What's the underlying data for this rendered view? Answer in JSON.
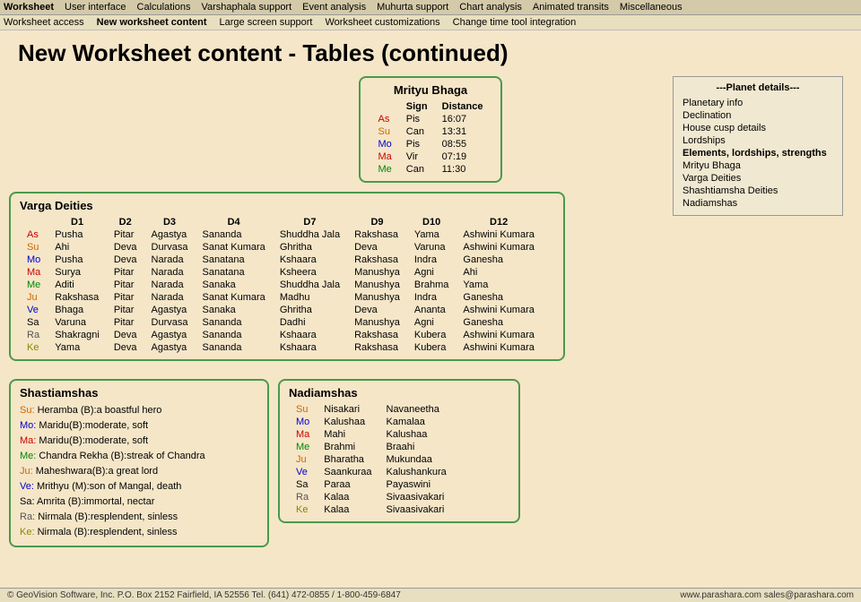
{
  "topnav": {
    "items": [
      {
        "label": "Worksheet",
        "bold": true
      },
      {
        "label": "User interface"
      },
      {
        "label": "Calculations"
      },
      {
        "label": "Varshaphala support"
      },
      {
        "label": "Event analysis"
      },
      {
        "label": "Muhurta support"
      },
      {
        "label": "Chart analysis"
      },
      {
        "label": "Animated transits"
      },
      {
        "label": "Miscellaneous"
      }
    ]
  },
  "secondnav": {
    "items": [
      {
        "label": "Worksheet access"
      },
      {
        "label": "New worksheet content",
        "bold": true
      },
      {
        "label": "Large screen support"
      },
      {
        "label": "Worksheet customizations"
      },
      {
        "label": "Change time tool integration"
      }
    ]
  },
  "page_title": "New Worksheet content - Tables (continued)",
  "mrityu": {
    "title": "Mrityu Bhaga",
    "col_headers": [
      "",
      "Sign",
      "Distance"
    ],
    "rows": [
      {
        "planet": "As",
        "color": "col-as",
        "sign": "Pis",
        "distance": "16:07"
      },
      {
        "planet": "Su",
        "color": "col-su",
        "sign": "Can",
        "distance": "13:31"
      },
      {
        "planet": "Mo",
        "color": "col-mo",
        "sign": "Pis",
        "distance": "08:55"
      },
      {
        "planet": "Ma",
        "color": "col-ma",
        "sign": "Vir",
        "distance": "07:19"
      },
      {
        "planet": "Me",
        "color": "col-me",
        "sign": "Can",
        "distance": "11:30"
      }
    ]
  },
  "varga": {
    "title": "Varga Deities",
    "col_headers": [
      "",
      "D1",
      "D2",
      "D3",
      "D4",
      "D7",
      "D9",
      "D10",
      "D12"
    ],
    "rows": [
      {
        "planet": "As",
        "color": "col-as",
        "d1": "Pusha",
        "d2": "Pitar",
        "d3": "Agastya",
        "d4": "Sananda",
        "d7": "Shuddha Jala",
        "d9": "Rakshasa",
        "d10": "Yama",
        "d12": "Ashwini Kumara"
      },
      {
        "planet": "Su",
        "color": "col-su",
        "d1": "Ahi",
        "d2": "Deva",
        "d3": "Durvasa",
        "d4": "Sanat Kumara",
        "d7": "Ghritha",
        "d9": "Deva",
        "d10": "Varuna",
        "d12": "Ashwini Kumara"
      },
      {
        "planet": "Mo",
        "color": "col-mo",
        "d1": "Pusha",
        "d2": "Deva",
        "d3": "Narada",
        "d4": "Sanatana",
        "d7": "Kshaara",
        "d9": "Rakshasa",
        "d10": "Indra",
        "d12": "Ganesha"
      },
      {
        "planet": "Ma",
        "color": "col-ma",
        "d1": "Surya",
        "d2": "Pitar",
        "d3": "Narada",
        "d4": "Sanatana",
        "d7": "Ksheera",
        "d9": "Manushya",
        "d10": "Agni",
        "d12": "Ahi"
      },
      {
        "planet": "Me",
        "color": "col-me",
        "d1": "Aditi",
        "d2": "Pitar",
        "d3": "Narada",
        "d4": "Sanaka",
        "d7": "Shuddha Jala",
        "d9": "Manushya",
        "d10": "Brahma",
        "d12": "Yama"
      },
      {
        "planet": "Ju",
        "color": "col-ju",
        "d1": "Rakshasa",
        "d2": "Pitar",
        "d3": "Narada",
        "d4": "Sanat Kumara",
        "d7": "Madhu",
        "d9": "Manushya",
        "d10": "Indra",
        "d12": "Ganesha"
      },
      {
        "planet": "Ve",
        "color": "col-ve",
        "d1": "Bhaga",
        "d2": "Pitar",
        "d3": "Agastya",
        "d4": "Sanaka",
        "d7": "Ghritha",
        "d9": "Deva",
        "d10": "Ananta",
        "d12": "Ashwini Kumara"
      },
      {
        "planet": "Sa",
        "color": "col-sa",
        "d1": "Varuna",
        "d2": "Pitar",
        "d3": "Durvasa",
        "d4": "Sananda",
        "d7": "Dadhi",
        "d9": "Manushya",
        "d10": "Agni",
        "d12": "Ganesha"
      },
      {
        "planet": "Ra",
        "color": "col-ra",
        "d1": "Shakragni",
        "d2": "Deva",
        "d3": "Agastya",
        "d4": "Sananda",
        "d7": "Kshaara",
        "d9": "Rakshasa",
        "d10": "Kubera",
        "d12": "Ashwini Kumara"
      },
      {
        "planet": "Ke",
        "color": "col-ke",
        "d1": "Yama",
        "d2": "Deva",
        "d3": "Agastya",
        "d4": "Sananda",
        "d7": "Kshaara",
        "d9": "Rakshasa",
        "d10": "Kubera",
        "d12": "Ashwini Kumara"
      }
    ]
  },
  "shastiamshas": {
    "title": "Shastiamshas",
    "lines": [
      {
        "planet": "Su:",
        "color": "col-su",
        "text": "Heramba (B):a boastful hero"
      },
      {
        "planet": "Mo:",
        "color": "col-mo",
        "text": "Maridu(B):moderate, soft"
      },
      {
        "planet": "Ma:",
        "color": "col-ma",
        "text": "Maridu(B):moderate, soft"
      },
      {
        "planet": "Me:",
        "color": "col-me",
        "text": "Chandra Rekha (B):streak of Chandra"
      },
      {
        "planet": "Ju:",
        "color": "col-ju",
        "text": "Maheshwara(B):a great lord"
      },
      {
        "planet": "Ve:",
        "color": "col-ve",
        "text": "Mrithyu (M):son of Mangal, death"
      },
      {
        "planet": "Sa:",
        "color": "col-sa",
        "text": "Amrita (B):immortal, nectar"
      },
      {
        "planet": "Ra:",
        "color": "col-ra",
        "text": "Nirmala (B):resplendent, sinless"
      },
      {
        "planet": "Ke:",
        "color": "col-ke",
        "text": "Nirmala (B):resplendent, sinless"
      }
    ]
  },
  "nadiamshas": {
    "title": "Nadiamshas",
    "rows": [
      {
        "planet": "Su",
        "color": "col-su",
        "col1": "Nisakari",
        "col2": "Navaneetha"
      },
      {
        "planet": "Mo",
        "color": "col-mo",
        "col1": "Kalushaa",
        "col2": "Kamalaa"
      },
      {
        "planet": "Ma",
        "color": "col-ma",
        "col1": "Mahi",
        "col2": "Kalushaa"
      },
      {
        "planet": "Me",
        "color": "col-me",
        "col1": "Brahmi",
        "col2": "Braahi"
      },
      {
        "planet": "Ju",
        "color": "col-ju",
        "col1": "Bharatha",
        "col2": "Mukundaa"
      },
      {
        "planet": "Ve",
        "color": "col-ve",
        "col1": "Saankuraa",
        "col2": "Kalushankura"
      },
      {
        "planet": "Sa",
        "color": "col-sa",
        "col1": "Paraa",
        "col2": "Payaswini"
      },
      {
        "planet": "Ra",
        "color": "col-ra",
        "col1": "Kalaa",
        "col2": "Sivaasivakari"
      },
      {
        "planet": "Ke",
        "color": "col-ke",
        "col1": "Kalaa",
        "col2": "Sivaasivakari"
      }
    ]
  },
  "planet_details": {
    "title": "---Planet details---",
    "items": [
      "Planetary info",
      "Declination",
      "House cusp details",
      "Lordships",
      "Elements, lordships, strengths",
      "Mrityu Bhaga",
      "Varga Deities",
      "Shashtiamsha Deities",
      "Nadiamshas"
    ]
  },
  "footer": {
    "left": "© GeoVision Software, Inc. P.O. Box 2152 Fairfield, IA 52556   Tel. (641) 472-0855 / 1-800-459-6847",
    "right": "www.parashara.com   sales@parashara.com"
  }
}
